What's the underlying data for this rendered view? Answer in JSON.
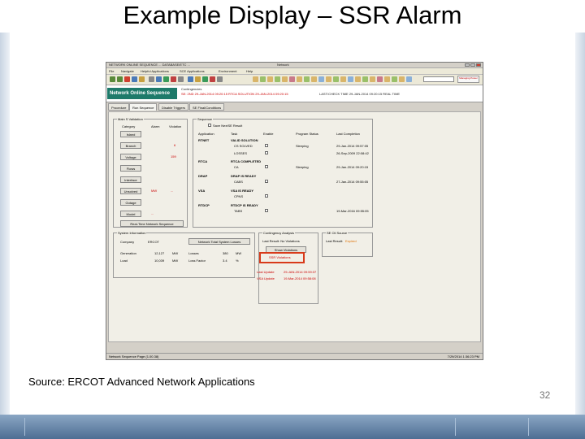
{
  "slide": {
    "title": "Example Display – SSR Alarm",
    "source": "Source: ERCOT Advanced Network Applications",
    "page_number": "32"
  },
  "window": {
    "title_left": "NETWORK ONLINE SEQUENCE ... DATABASE/ETC ...",
    "title_center": "Network",
    "menu": [
      "File",
      "Navigate",
      "Helpful Applications",
      "SCE Applications",
      "Environment",
      "Help"
    ],
    "brand": "Managing Power"
  },
  "header": {
    "nav_title": "Network Online Sequence",
    "breadcrumb": "Contingencies",
    "status": "SE: 2ND  29-JAN-2014 09:20:15    RTCA SOLUTION  29-JAN-2014 09:20:15",
    "status2": "LAST/CHECK TIME  29-JAN-2014 09:20:15    REAL TIME"
  },
  "tabs": [
    "Procedure",
    "Run Sequence",
    "Disable Triggers",
    "SE Final/Conditions"
  ],
  "main_status": {
    "group_label": "Main S Validation",
    "col_category": "Category",
    "col_alarm": "Alarm",
    "col_violation": "Violation",
    "rows": [
      {
        "label": "Island",
        "alarm": "",
        "violation": ""
      },
      {
        "label": "Branch",
        "alarm": "",
        "violation": "6"
      },
      {
        "label": "Voltage",
        "alarm": "",
        "violation": "159"
      },
      {
        "label": "Flows",
        "alarm": "",
        "violation": ""
      },
      {
        "label": "Interface",
        "alarm": "",
        "violation": ""
      },
      {
        "label": "Unsolved",
        "alarm": "MW",
        "violation": "..."
      },
      {
        "label": "Outage",
        "alarm": "",
        "violation": ""
      },
      {
        "label": "Model",
        "alarm": "...",
        "violation": ""
      }
    ],
    "realtime_btn": "Real-Time Network Sequence"
  },
  "sequence": {
    "group_label": "Sequence",
    "save_label": "Save NextSE Result",
    "cols": [
      "Application",
      "Task",
      "Enable",
      "Program Status",
      "Last Completion"
    ],
    "rows": [
      {
        "app": "RTNET",
        "task": "VALID SOLUTION",
        "sub": "CS SOLVED",
        "status": "Sleeping",
        "time": "29-Jan-2014 09:57:05"
      },
      {
        "app": "",
        "task": "",
        "sub": "LOSSES",
        "status": "",
        "time": "26-Sep-2009 22:08:42"
      },
      {
        "app": "RTCA",
        "task": "RTCA COMPLETED",
        "sub": "CA",
        "status": "Sleeping",
        "time": "29-Jan-2014 09:20:15"
      },
      {
        "app": "DRAP",
        "task": "DRAP IS READY",
        "sub": "CABS",
        "status": "",
        "time": "27-Jan-2014 09:55:05"
      },
      {
        "app": "VSA",
        "task": "VSA IS READY",
        "sub": "CPNS",
        "status": "",
        "time": ""
      },
      {
        "app": "RTDCP",
        "task": "RTDCP IS READY",
        "sub": "TABS",
        "status": "",
        "time": "19-Mar-2016 09:55:05"
      }
    ]
  },
  "bottom": {
    "system_label": "System Information",
    "company_label": "Company",
    "company_val": "ERCOT",
    "network_btn": "Network Total System Losses",
    "gen_label": "Generation",
    "gen_val": "12,127",
    "gen_unit": "MW",
    "load_label": "Load",
    "load_val": "10,039",
    "load_unit": "MW",
    "losses_label": "Losses",
    "losses_val": "380",
    "losses_unit": "MW",
    "loss_pct_label": "Loss Factor",
    "loss_pct_val": "3.4",
    "loss_pct_unit": "%",
    "conting_label": "Contingency Analysis",
    "last_result": "Last Result: No Violations",
    "show_btn": "Show Violations",
    "ssr_alarm": "SSR Violations",
    "ssr_label": "SE Ctl Source",
    "ssr_result": "Last Result:",
    "ssr_result_val": "Expired",
    "last_update": "Last Update",
    "last_update_val": "29-JAN-2014 09:59:37",
    "vsa_update": "VSA Update",
    "vsa_update_val": "19-Mar-2014 09:58:08"
  },
  "statusbar": {
    "left": "Network Sequence Page (1.00.38)",
    "right": "7/29/2014  1:36:23 PM"
  }
}
